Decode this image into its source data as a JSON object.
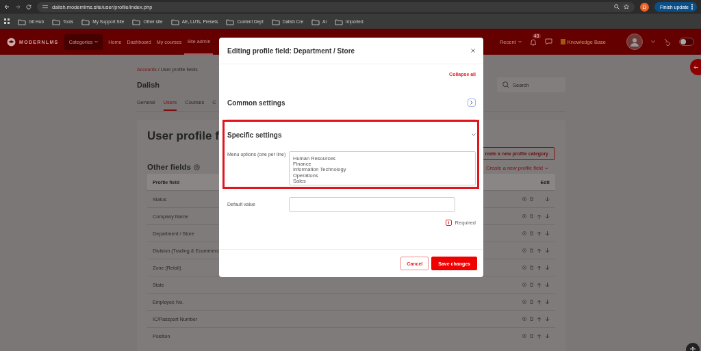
{
  "browser": {
    "url": "dalish.modernlms.site/user/profile/index.php",
    "profile_initial": "D",
    "update_button": "Finish update",
    "bookmarks": [
      "Git Hub",
      "Tools",
      "My Support Site",
      "Other site",
      "AE, LUTs, Presets",
      "Content Dept",
      "Dalish Cre",
      "Ai",
      "Imported"
    ]
  },
  "navbar": {
    "logo": "MODERNLMS",
    "items": [
      {
        "label": "Categories",
        "kind": "dropdown",
        "selected": false
      },
      {
        "label": "Home",
        "kind": "link",
        "selected": false
      },
      {
        "label": "Dashboard",
        "kind": "link",
        "selected": false
      },
      {
        "label": "My courses",
        "kind": "link",
        "selected": false
      },
      {
        "label": "Site admin",
        "kind": "link",
        "selected": true
      }
    ],
    "recent": "Recent",
    "notifications": "43",
    "knowledge_base": "Knowledge Base",
    "dark_mode": false
  },
  "page": {
    "breadcrumb": [
      {
        "label": "Accounts",
        "kind": "link"
      },
      {
        "label": "/ User profile fields",
        "kind": "text"
      }
    ],
    "title": "Dalish",
    "search": {
      "placeholder": "Search"
    },
    "tabs": [
      {
        "label": "General",
        "selected": false
      },
      {
        "label": "Users",
        "selected": true
      },
      {
        "label": "Courses",
        "selected": false
      },
      {
        "label": "C",
        "selected": false
      }
    ],
    "heading": "User profile f",
    "category_button": "reate a new profile category",
    "field_button": "Create a new profile field",
    "section": "Other fields",
    "table": {
      "columns": [
        "Profile field",
        "Edit"
      ],
      "rows": [
        {
          "name": "Status",
          "up": false
        },
        {
          "name": "Company Name",
          "up": true
        },
        {
          "name": "Department / Store",
          "up": true
        },
        {
          "name": "Division (Trading & Ecommerc",
          "up": true
        },
        {
          "name": "Zone (Retail)",
          "up": true
        },
        {
          "name": "State",
          "up": true
        },
        {
          "name": "Employee No.",
          "up": true
        },
        {
          "name": "IC/Passport Number",
          "up": true
        },
        {
          "name": "Position",
          "up": true
        }
      ]
    }
  },
  "modal": {
    "title": "Editing profile field: Department / Store",
    "collapse_all": "Collapse all",
    "sections": [
      {
        "title": "Common settings",
        "expanded": false,
        "highlighted": false
      },
      {
        "title": "Specific settings",
        "expanded": true,
        "highlighted": true
      }
    ],
    "menu_options": {
      "label": "Menu options (one per line)",
      "lines": [
        "Human Resources",
        "Finance",
        "Information Technology",
        "Operations",
        "Sales"
      ]
    },
    "default_value": {
      "label": "Default value"
    },
    "required": "Required",
    "buttons": [
      {
        "label": "Cancel",
        "kind": "secondary"
      },
      {
        "label": "Save changes",
        "kind": "primary"
      }
    ]
  }
}
